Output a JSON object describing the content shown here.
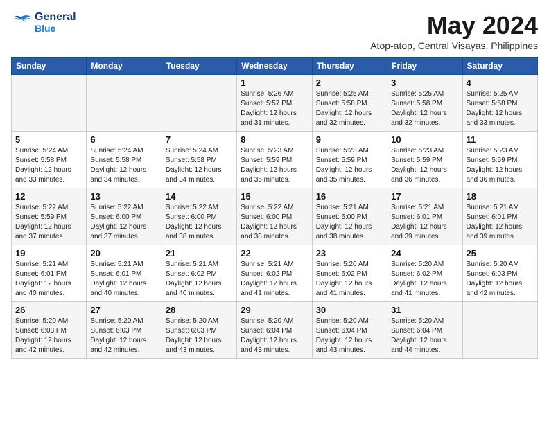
{
  "header": {
    "logo_line1": "General",
    "logo_line2": "Blue",
    "month_title": "May 2024",
    "location": "Atop-atop, Central Visayas, Philippines"
  },
  "weekdays": [
    "Sunday",
    "Monday",
    "Tuesday",
    "Wednesday",
    "Thursday",
    "Friday",
    "Saturday"
  ],
  "weeks": [
    {
      "days": [
        {
          "num": "",
          "info": ""
        },
        {
          "num": "",
          "info": ""
        },
        {
          "num": "",
          "info": ""
        },
        {
          "num": "1",
          "info": "Sunrise: 5:26 AM\nSunset: 5:57 PM\nDaylight: 12 hours\nand 31 minutes."
        },
        {
          "num": "2",
          "info": "Sunrise: 5:25 AM\nSunset: 5:58 PM\nDaylight: 12 hours\nand 32 minutes."
        },
        {
          "num": "3",
          "info": "Sunrise: 5:25 AM\nSunset: 5:58 PM\nDaylight: 12 hours\nand 32 minutes."
        },
        {
          "num": "4",
          "info": "Sunrise: 5:25 AM\nSunset: 5:58 PM\nDaylight: 12 hours\nand 33 minutes."
        }
      ]
    },
    {
      "days": [
        {
          "num": "5",
          "info": "Sunrise: 5:24 AM\nSunset: 5:58 PM\nDaylight: 12 hours\nand 33 minutes."
        },
        {
          "num": "6",
          "info": "Sunrise: 5:24 AM\nSunset: 5:58 PM\nDaylight: 12 hours\nand 34 minutes."
        },
        {
          "num": "7",
          "info": "Sunrise: 5:24 AM\nSunset: 5:58 PM\nDaylight: 12 hours\nand 34 minutes."
        },
        {
          "num": "8",
          "info": "Sunrise: 5:23 AM\nSunset: 5:59 PM\nDaylight: 12 hours\nand 35 minutes."
        },
        {
          "num": "9",
          "info": "Sunrise: 5:23 AM\nSunset: 5:59 PM\nDaylight: 12 hours\nand 35 minutes."
        },
        {
          "num": "10",
          "info": "Sunrise: 5:23 AM\nSunset: 5:59 PM\nDaylight: 12 hours\nand 36 minutes."
        },
        {
          "num": "11",
          "info": "Sunrise: 5:23 AM\nSunset: 5:59 PM\nDaylight: 12 hours\nand 36 minutes."
        }
      ]
    },
    {
      "days": [
        {
          "num": "12",
          "info": "Sunrise: 5:22 AM\nSunset: 5:59 PM\nDaylight: 12 hours\nand 37 minutes."
        },
        {
          "num": "13",
          "info": "Sunrise: 5:22 AM\nSunset: 6:00 PM\nDaylight: 12 hours\nand 37 minutes."
        },
        {
          "num": "14",
          "info": "Sunrise: 5:22 AM\nSunset: 6:00 PM\nDaylight: 12 hours\nand 38 minutes."
        },
        {
          "num": "15",
          "info": "Sunrise: 5:22 AM\nSunset: 6:00 PM\nDaylight: 12 hours\nand 38 minutes."
        },
        {
          "num": "16",
          "info": "Sunrise: 5:21 AM\nSunset: 6:00 PM\nDaylight: 12 hours\nand 38 minutes."
        },
        {
          "num": "17",
          "info": "Sunrise: 5:21 AM\nSunset: 6:01 PM\nDaylight: 12 hours\nand 39 minutes."
        },
        {
          "num": "18",
          "info": "Sunrise: 5:21 AM\nSunset: 6:01 PM\nDaylight: 12 hours\nand 39 minutes."
        }
      ]
    },
    {
      "days": [
        {
          "num": "19",
          "info": "Sunrise: 5:21 AM\nSunset: 6:01 PM\nDaylight: 12 hours\nand 40 minutes."
        },
        {
          "num": "20",
          "info": "Sunrise: 5:21 AM\nSunset: 6:01 PM\nDaylight: 12 hours\nand 40 minutes."
        },
        {
          "num": "21",
          "info": "Sunrise: 5:21 AM\nSunset: 6:02 PM\nDaylight: 12 hours\nand 40 minutes."
        },
        {
          "num": "22",
          "info": "Sunrise: 5:21 AM\nSunset: 6:02 PM\nDaylight: 12 hours\nand 41 minutes."
        },
        {
          "num": "23",
          "info": "Sunrise: 5:20 AM\nSunset: 6:02 PM\nDaylight: 12 hours\nand 41 minutes."
        },
        {
          "num": "24",
          "info": "Sunrise: 5:20 AM\nSunset: 6:02 PM\nDaylight: 12 hours\nand 41 minutes."
        },
        {
          "num": "25",
          "info": "Sunrise: 5:20 AM\nSunset: 6:03 PM\nDaylight: 12 hours\nand 42 minutes."
        }
      ]
    },
    {
      "days": [
        {
          "num": "26",
          "info": "Sunrise: 5:20 AM\nSunset: 6:03 PM\nDaylight: 12 hours\nand 42 minutes."
        },
        {
          "num": "27",
          "info": "Sunrise: 5:20 AM\nSunset: 6:03 PM\nDaylight: 12 hours\nand 42 minutes."
        },
        {
          "num": "28",
          "info": "Sunrise: 5:20 AM\nSunset: 6:03 PM\nDaylight: 12 hours\nand 43 minutes."
        },
        {
          "num": "29",
          "info": "Sunrise: 5:20 AM\nSunset: 6:04 PM\nDaylight: 12 hours\nand 43 minutes."
        },
        {
          "num": "30",
          "info": "Sunrise: 5:20 AM\nSunset: 6:04 PM\nDaylight: 12 hours\nand 43 minutes."
        },
        {
          "num": "31",
          "info": "Sunrise: 5:20 AM\nSunset: 6:04 PM\nDaylight: 12 hours\nand 44 minutes."
        },
        {
          "num": "",
          "info": ""
        }
      ]
    }
  ]
}
